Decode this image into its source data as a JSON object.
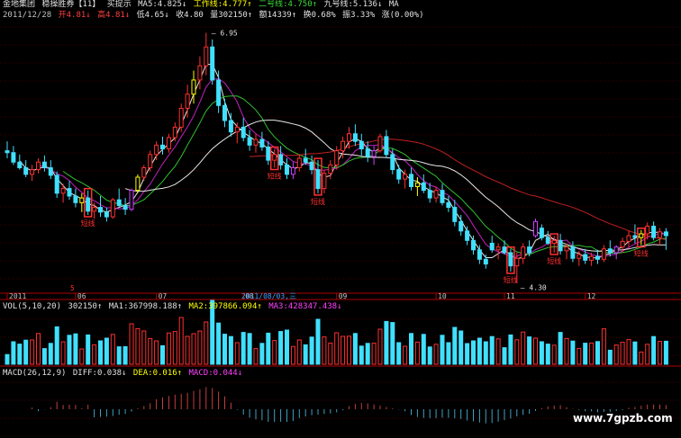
{
  "header1": {
    "stock_name": "金地集团",
    "indicator_name": "稳操胜券【11】",
    "hint": "买提示",
    "ma5": "MA5:4.825↓",
    "work_line": "工作线:4.777↑",
    "line2": "二号线:4.750↑",
    "line9": "九号线:5.136↓",
    "ma_tail": "MA"
  },
  "header2": {
    "date": "2011/12/28",
    "open": "开4.81↓",
    "high": "高4.81↓",
    "low": "低4.65↓",
    "close": "收4.80",
    "volume": "量302150↑",
    "amount": "额14339↑",
    "turnover": "换0.68%",
    "amplitude": "振3.33%",
    "change": "涨(0.00%)"
  },
  "vol_header": {
    "name": "VOL(5,10,20)",
    "value": "302150↑",
    "ma1": "MA1:367998.188↑",
    "ma2": "MA2:397866.094↑",
    "ma3": "MA3:428347.438↓"
  },
  "macd_header": {
    "name": "MACD(26,12,9)",
    "diff": "DIFF:0.038↓",
    "dea": "DEA:0.016↑",
    "macd": "MACD:0.044↓"
  },
  "watermark": "www.7gpzb.com",
  "colors": {
    "up": "#ff3030",
    "down": "#40e0ff",
    "signal_yellow": "#ffff00",
    "signal_magenta": "#d040ff",
    "ma_white": "#e8e8e8",
    "ma_green": "#30c030",
    "ma_magenta": "#c020c0",
    "ma_red": "#c02020",
    "grid": "#800000"
  },
  "chart_data": {
    "type": "candlestick",
    "annotations": {
      "peak_label": "6.95",
      "trough_label": "4.30",
      "date_label": "2011/08/03,三",
      "short_line_label": "短线",
      "red_marker": "5"
    },
    "x_tick_labels": [
      "2011",
      "06",
      "07",
      "08",
      "09",
      "10",
      "11",
      "12"
    ],
    "candles": [
      [
        5.7,
        5.8,
        5.62,
        5.68
      ],
      [
        5.68,
        5.75,
        5.55,
        5.58
      ],
      [
        5.58,
        5.66,
        5.5,
        5.52
      ],
      [
        5.52,
        5.6,
        5.42,
        5.45
      ],
      [
        5.45,
        5.55,
        5.38,
        5.5
      ],
      [
        5.5,
        5.62,
        5.46,
        5.58
      ],
      [
        5.58,
        5.65,
        5.48,
        5.52
      ],
      [
        5.52,
        5.6,
        5.4,
        5.44
      ],
      [
        5.44,
        5.48,
        5.2,
        5.25
      ],
      [
        5.25,
        5.35,
        5.15,
        5.3
      ],
      [
        5.3,
        5.38,
        5.18,
        5.22
      ],
      [
        5.22,
        5.3,
        5.1,
        5.15
      ],
      [
        5.15,
        5.25,
        5.05,
        5.2
      ],
      [
        5.2,
        5.28,
        5.02,
        5.06
      ],
      [
        5.06,
        5.15,
        4.98,
        5.1
      ],
      [
        5.1,
        5.22,
        5.0,
        5.05
      ],
      [
        5.05,
        5.1,
        4.95,
        5.0
      ],
      [
        5.0,
        5.2,
        4.98,
        5.18
      ],
      [
        5.18,
        5.3,
        5.1,
        5.12
      ],
      [
        5.12,
        5.2,
        5.02,
        5.08
      ],
      [
        5.08,
        5.3,
        5.06,
        5.28
      ],
      [
        5.28,
        5.45,
        5.25,
        5.42
      ],
      [
        5.42,
        5.55,
        5.38,
        5.52
      ],
      [
        5.52,
        5.7,
        5.48,
        5.66
      ],
      [
        5.66,
        5.8,
        5.6,
        5.76
      ],
      [
        5.76,
        5.85,
        5.66,
        5.72
      ],
      [
        5.72,
        5.88,
        5.68,
        5.84
      ],
      [
        5.84,
        6.0,
        5.8,
        5.95
      ],
      [
        5.95,
        6.2,
        5.9,
        6.15
      ],
      [
        6.15,
        6.4,
        6.05,
        6.3
      ],
      [
        6.3,
        6.55,
        6.2,
        6.45
      ],
      [
        6.45,
        6.7,
        6.35,
        6.6
      ],
      [
        6.6,
        6.95,
        6.5,
        6.8
      ],
      [
        6.8,
        6.88,
        6.4,
        6.45
      ],
      [
        6.45,
        6.55,
        6.1,
        6.18
      ],
      [
        6.18,
        6.25,
        5.95,
        6.02
      ],
      [
        6.02,
        6.1,
        5.85,
        5.9
      ],
      [
        5.9,
        6.0,
        5.78,
        5.95
      ],
      [
        5.95,
        6.05,
        5.8,
        5.84
      ],
      [
        5.84,
        5.92,
        5.7,
        5.76
      ],
      [
        5.76,
        5.88,
        5.68,
        5.82
      ],
      [
        5.82,
        5.9,
        5.7,
        5.74
      ],
      [
        5.74,
        5.8,
        5.55,
        5.6
      ],
      [
        5.6,
        5.72,
        5.52,
        5.66
      ],
      [
        5.66,
        5.75,
        5.5,
        5.55
      ],
      [
        5.55,
        5.62,
        5.4,
        5.45
      ],
      [
        5.45,
        5.58,
        5.4,
        5.52
      ],
      [
        5.52,
        5.66,
        5.48,
        5.62
      ],
      [
        5.62,
        5.72,
        5.55,
        5.58
      ],
      [
        5.58,
        5.65,
        5.45,
        5.5
      ],
      [
        5.5,
        5.6,
        5.25,
        5.3
      ],
      [
        5.3,
        5.5,
        5.25,
        5.46
      ],
      [
        5.46,
        5.6,
        5.4,
        5.55
      ],
      [
        5.55,
        5.75,
        5.5,
        5.7
      ],
      [
        5.7,
        5.85,
        5.62,
        5.8
      ],
      [
        5.8,
        5.95,
        5.72,
        5.88
      ],
      [
        5.88,
        5.98,
        5.75,
        5.8
      ],
      [
        5.8,
        5.88,
        5.65,
        5.72
      ],
      [
        5.72,
        5.8,
        5.58,
        5.64
      ],
      [
        5.64,
        5.75,
        5.55,
        5.7
      ],
      [
        5.7,
        5.88,
        5.68,
        5.85
      ],
      [
        5.85,
        5.92,
        5.62,
        5.66
      ],
      [
        5.66,
        5.72,
        5.45,
        5.5
      ],
      [
        5.5,
        5.55,
        5.35,
        5.4
      ],
      [
        5.4,
        5.5,
        5.3,
        5.45
      ],
      [
        5.45,
        5.52,
        5.28,
        5.32
      ],
      [
        5.32,
        5.42,
        5.22,
        5.36
      ],
      [
        5.36,
        5.45,
        5.25,
        5.28
      ],
      [
        5.28,
        5.36,
        5.15,
        5.2
      ],
      [
        5.2,
        5.32,
        5.15,
        5.28
      ],
      [
        5.28,
        5.35,
        5.12,
        5.15
      ],
      [
        5.15,
        5.22,
        5.05,
        5.1
      ],
      [
        5.1,
        5.18,
        4.9,
        4.95
      ],
      [
        4.95,
        5.02,
        4.8,
        4.85
      ],
      [
        4.85,
        4.9,
        4.7,
        4.75
      ],
      [
        4.75,
        4.8,
        4.6,
        4.65
      ],
      [
        4.65,
        4.7,
        4.5,
        4.55
      ],
      [
        4.55,
        4.6,
        4.45,
        4.5
      ],
      [
        4.72,
        4.8,
        4.62,
        4.65
      ],
      [
        4.65,
        4.72,
        4.55,
        4.68
      ],
      [
        4.68,
        4.75,
        4.6,
        4.62
      ],
      [
        4.62,
        4.66,
        4.42,
        4.48
      ],
      [
        4.48,
        4.62,
        4.3,
        4.56
      ],
      [
        4.56,
        4.72,
        4.5,
        4.68
      ],
      [
        4.68,
        4.75,
        4.58,
        4.62
      ],
      [
        4.8,
        4.98,
        4.78,
        4.95
      ],
      [
        4.88,
        4.92,
        4.75,
        4.78
      ],
      [
        4.78,
        4.85,
        4.7,
        4.72
      ],
      [
        4.72,
        4.8,
        4.62,
        4.75
      ],
      [
        4.75,
        4.82,
        4.6,
        4.64
      ],
      [
        4.64,
        4.72,
        4.55,
        4.68
      ],
      [
        4.68,
        4.74,
        4.52,
        4.56
      ],
      [
        4.56,
        4.64,
        4.48,
        4.6
      ],
      [
        4.6,
        4.66,
        4.5,
        4.54
      ],
      [
        4.54,
        4.62,
        4.48,
        4.58
      ],
      [
        4.58,
        4.65,
        4.5,
        4.55
      ],
      [
        4.55,
        4.7,
        4.52,
        4.66
      ],
      [
        4.66,
        4.75,
        4.58,
        4.62
      ],
      [
        4.62,
        4.7,
        4.55,
        4.68
      ],
      [
        4.68,
        4.78,
        4.62,
        4.74
      ],
      [
        4.74,
        4.85,
        4.68,
        4.8
      ],
      [
        4.8,
        4.92,
        4.72,
        4.78
      ],
      [
        4.78,
        4.86,
        4.7,
        4.82
      ],
      [
        4.82,
        4.94,
        4.76,
        4.9
      ],
      [
        4.9,
        4.95,
        4.75,
        4.78
      ],
      [
        4.78,
        4.88,
        4.7,
        4.84
      ],
      [
        4.84,
        4.88,
        4.65,
        4.8
      ]
    ]
  }
}
